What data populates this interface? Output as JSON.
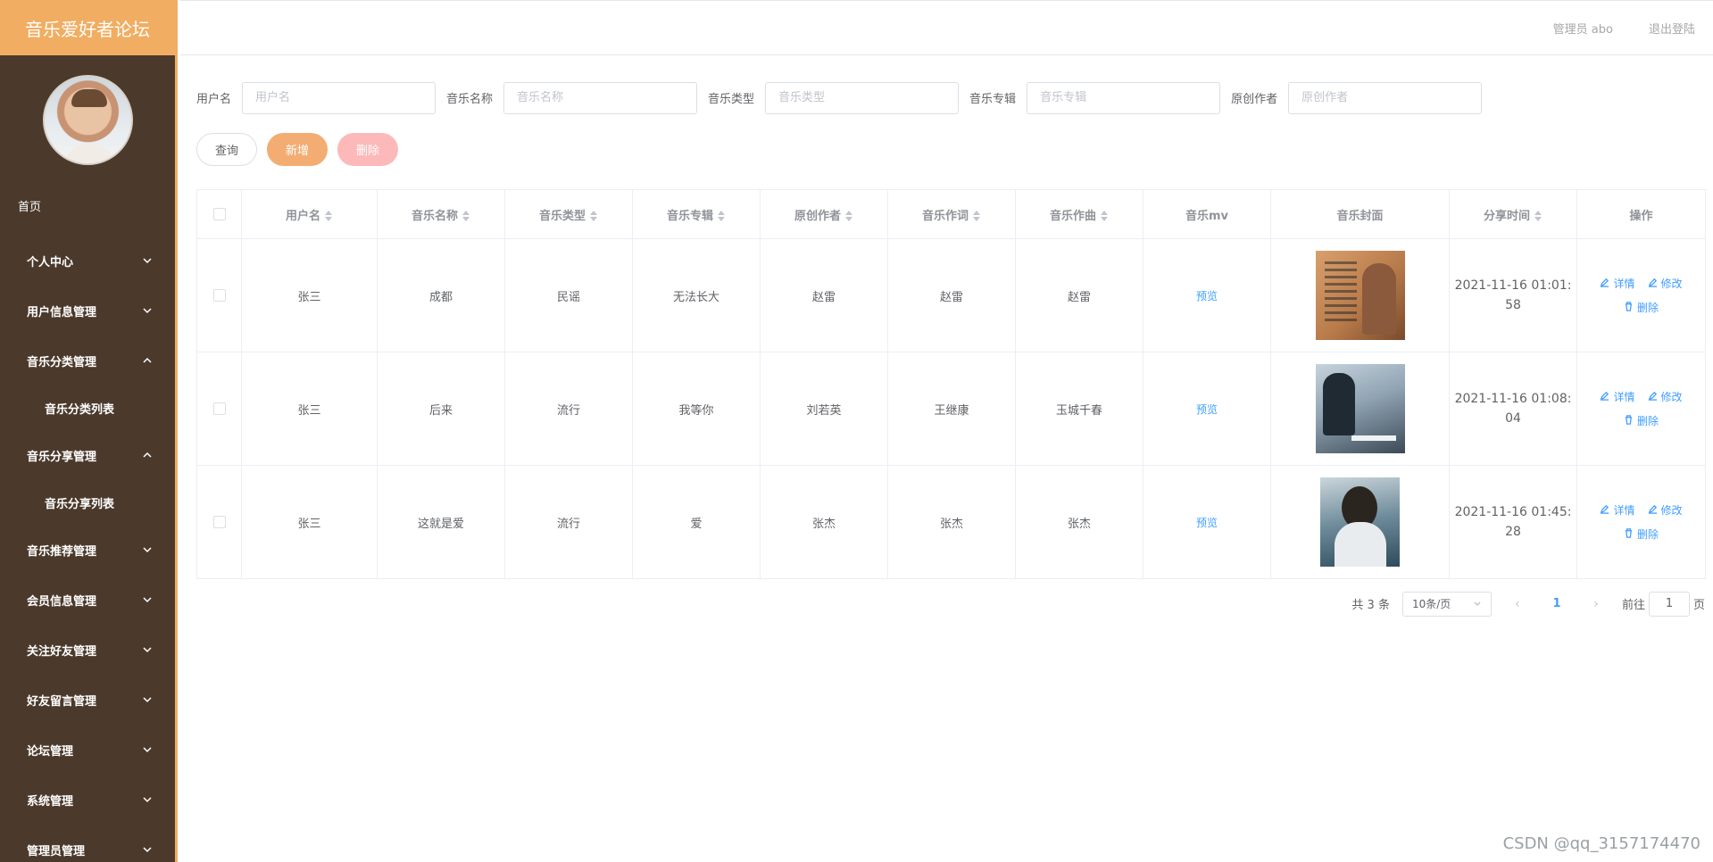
{
  "app": {
    "title": "音乐爱好者论坛"
  },
  "header": {
    "user": "管理员 abo",
    "logout": "退出登陆"
  },
  "sidebar": {
    "home": "首页",
    "items": [
      {
        "label": "个人中心"
      },
      {
        "label": "用户信息管理"
      },
      {
        "label": "音乐分类管理",
        "sub": "音乐分类列表"
      },
      {
        "label": "音乐分享管理",
        "sub": "音乐分享列表"
      },
      {
        "label": "音乐推荐管理"
      },
      {
        "label": "会员信息管理"
      },
      {
        "label": "关注好友管理"
      },
      {
        "label": "好友留言管理"
      },
      {
        "label": "论坛管理"
      },
      {
        "label": "系统管理"
      },
      {
        "label": "管理员管理"
      }
    ]
  },
  "filters": {
    "username": {
      "label": "用户名",
      "placeholder": "用户名"
    },
    "music_name": {
      "label": "音乐名称",
      "placeholder": "音乐名称"
    },
    "music_type": {
      "label": "音乐类型",
      "placeholder": "音乐类型"
    },
    "album": {
      "label": "音乐专辑",
      "placeholder": "音乐专辑"
    },
    "author": {
      "label": "原创作者",
      "placeholder": "原创作者"
    }
  },
  "actions": {
    "query": "查询",
    "add": "新增",
    "delete": "删除"
  },
  "table": {
    "headers": [
      "用户名",
      "音乐名称",
      "音乐类型",
      "音乐专辑",
      "原创作者",
      "音乐作词",
      "音乐作曲",
      "音乐mv",
      "音乐封面",
      "分享时间",
      "操作"
    ],
    "rows": [
      {
        "username": "张三",
        "name": "成都",
        "type": "民谣",
        "album": "无法长大",
        "author": "赵雷",
        "lyricist": "赵雷",
        "composer": "赵雷",
        "mv": "预览",
        "time_line1": "2021-11-16 01:01:",
        "time_line2": "58"
      },
      {
        "username": "张三",
        "name": "后来",
        "type": "流行",
        "album": "我等你",
        "author": "刘若英",
        "lyricist": "王继康",
        "composer": "玉城千春",
        "mv": "预览",
        "time_line1": "2021-11-16 01:08:",
        "time_line2": "04"
      },
      {
        "username": "张三",
        "name": "这就是爱",
        "type": "流行",
        "album": "爱",
        "author": "张杰",
        "lyricist": "张杰",
        "composer": "张杰",
        "mv": "预览",
        "time_line1": "2021-11-16 01:45:",
        "time_line2": "28"
      }
    ],
    "ops": {
      "detail": "详情",
      "edit": "修改",
      "delete": "删除"
    }
  },
  "pagination": {
    "total": "共 3 条",
    "page_size": "10条/页",
    "current": "1",
    "goto_prefix": "前往",
    "goto_value": "1",
    "goto_suffix": "页"
  },
  "watermark": "CSDN @qq_3157174470"
}
